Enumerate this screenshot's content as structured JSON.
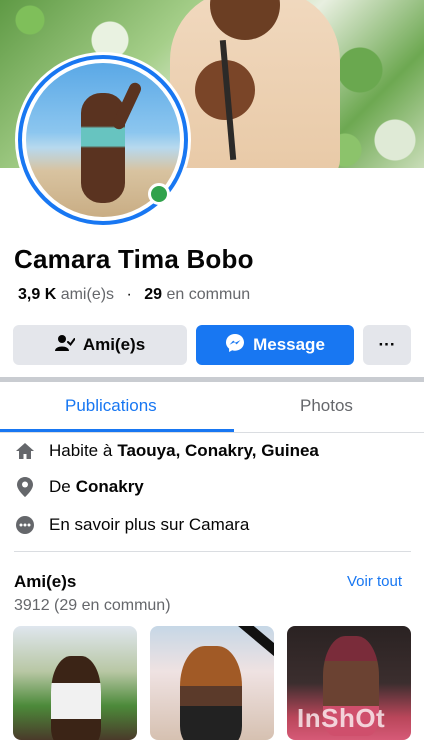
{
  "profile": {
    "name": "Camara Tima Bobo",
    "friends_count": "3,9 K",
    "friends_label": "ami(e)s",
    "mutual_count": "29",
    "mutual_label": "en commun",
    "online": true
  },
  "actions": {
    "friends_label": "Ami(e)s",
    "message_label": "Message",
    "more_label": "···"
  },
  "tabs": [
    {
      "label": "Publications",
      "active": true
    },
    {
      "label": "Photos",
      "active": false
    }
  ],
  "info": {
    "lives_prefix": "Habite à",
    "lives_value": "Taouya, Conakry, Guinea",
    "from_prefix": "De",
    "from_value": "Conakry",
    "about_label": "En savoir plus sur Camara"
  },
  "friends_section": {
    "title": "Ami(e)s",
    "see_all": "Voir tout",
    "count_text": "3912 (29 en commun)"
  },
  "watermark": "InShOt",
  "colors": {
    "accent": "#1877f2",
    "online": "#31a24c",
    "button_gray": "#e4e6eb",
    "secondary_text": "#65676b"
  },
  "icons": [
    "home-icon",
    "location-pin-icon",
    "more-dots-icon",
    "friends-check-icon",
    "messenger-icon"
  ]
}
